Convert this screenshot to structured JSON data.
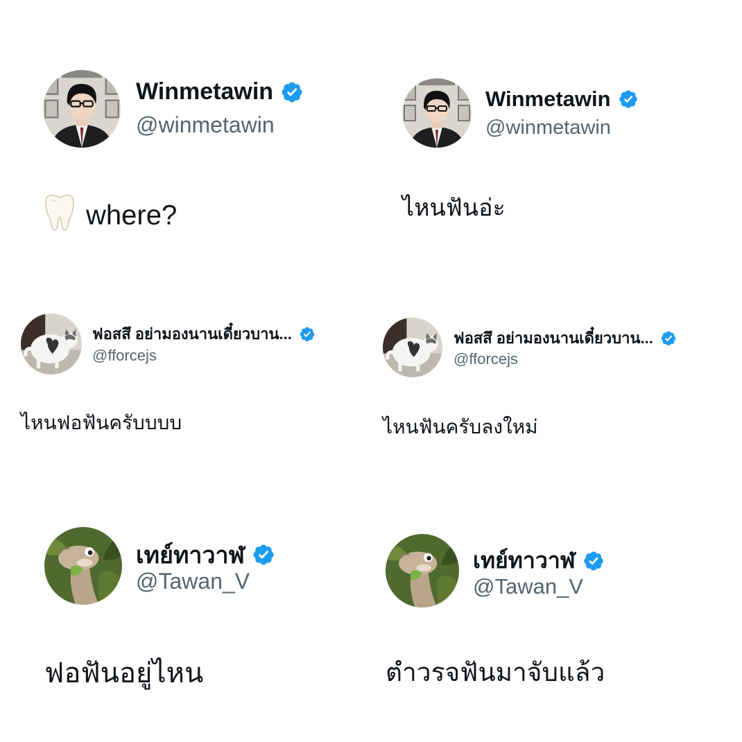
{
  "colors": {
    "verified": "#1d9bf0",
    "handle": "#536471",
    "text": "#0f1419"
  },
  "tweets": [
    {
      "name": "Winmetawin",
      "handle": "@winmetawin",
      "text": "where?",
      "emoji": "tooth-emoji",
      "avatar": "person-avatar"
    },
    {
      "name": "Winmetawin",
      "handle": "@winmetawin",
      "text": "ไหนฟันอ่ะ",
      "avatar": "person-avatar"
    },
    {
      "name": "ฟอสสึ อย่ามองนานเดี๋ยวบาน...",
      "handle": "@fforcejs",
      "text": "ไหนฟอฟันครับบบบ",
      "avatar": "cat-avatar"
    },
    {
      "name": "ฟอสสึ อย่ามองนานเดี๋ยวบาน...",
      "handle": "@fforcejs",
      "text": "ไหนฟันครับลงใหม่",
      "avatar": "cat-avatar"
    },
    {
      "name": "เทย์ทาวาฬ",
      "handle": "@Tawan_V",
      "text": "ฟอฟันอยู่ไหน",
      "avatar": "dinosaur-avatar"
    },
    {
      "name": "เทย์ทาวาฬ",
      "handle": "@Tawan_V",
      "text": "ตำวรจฟันมาจับแล้ว",
      "avatar": "dinosaur-avatar"
    }
  ]
}
